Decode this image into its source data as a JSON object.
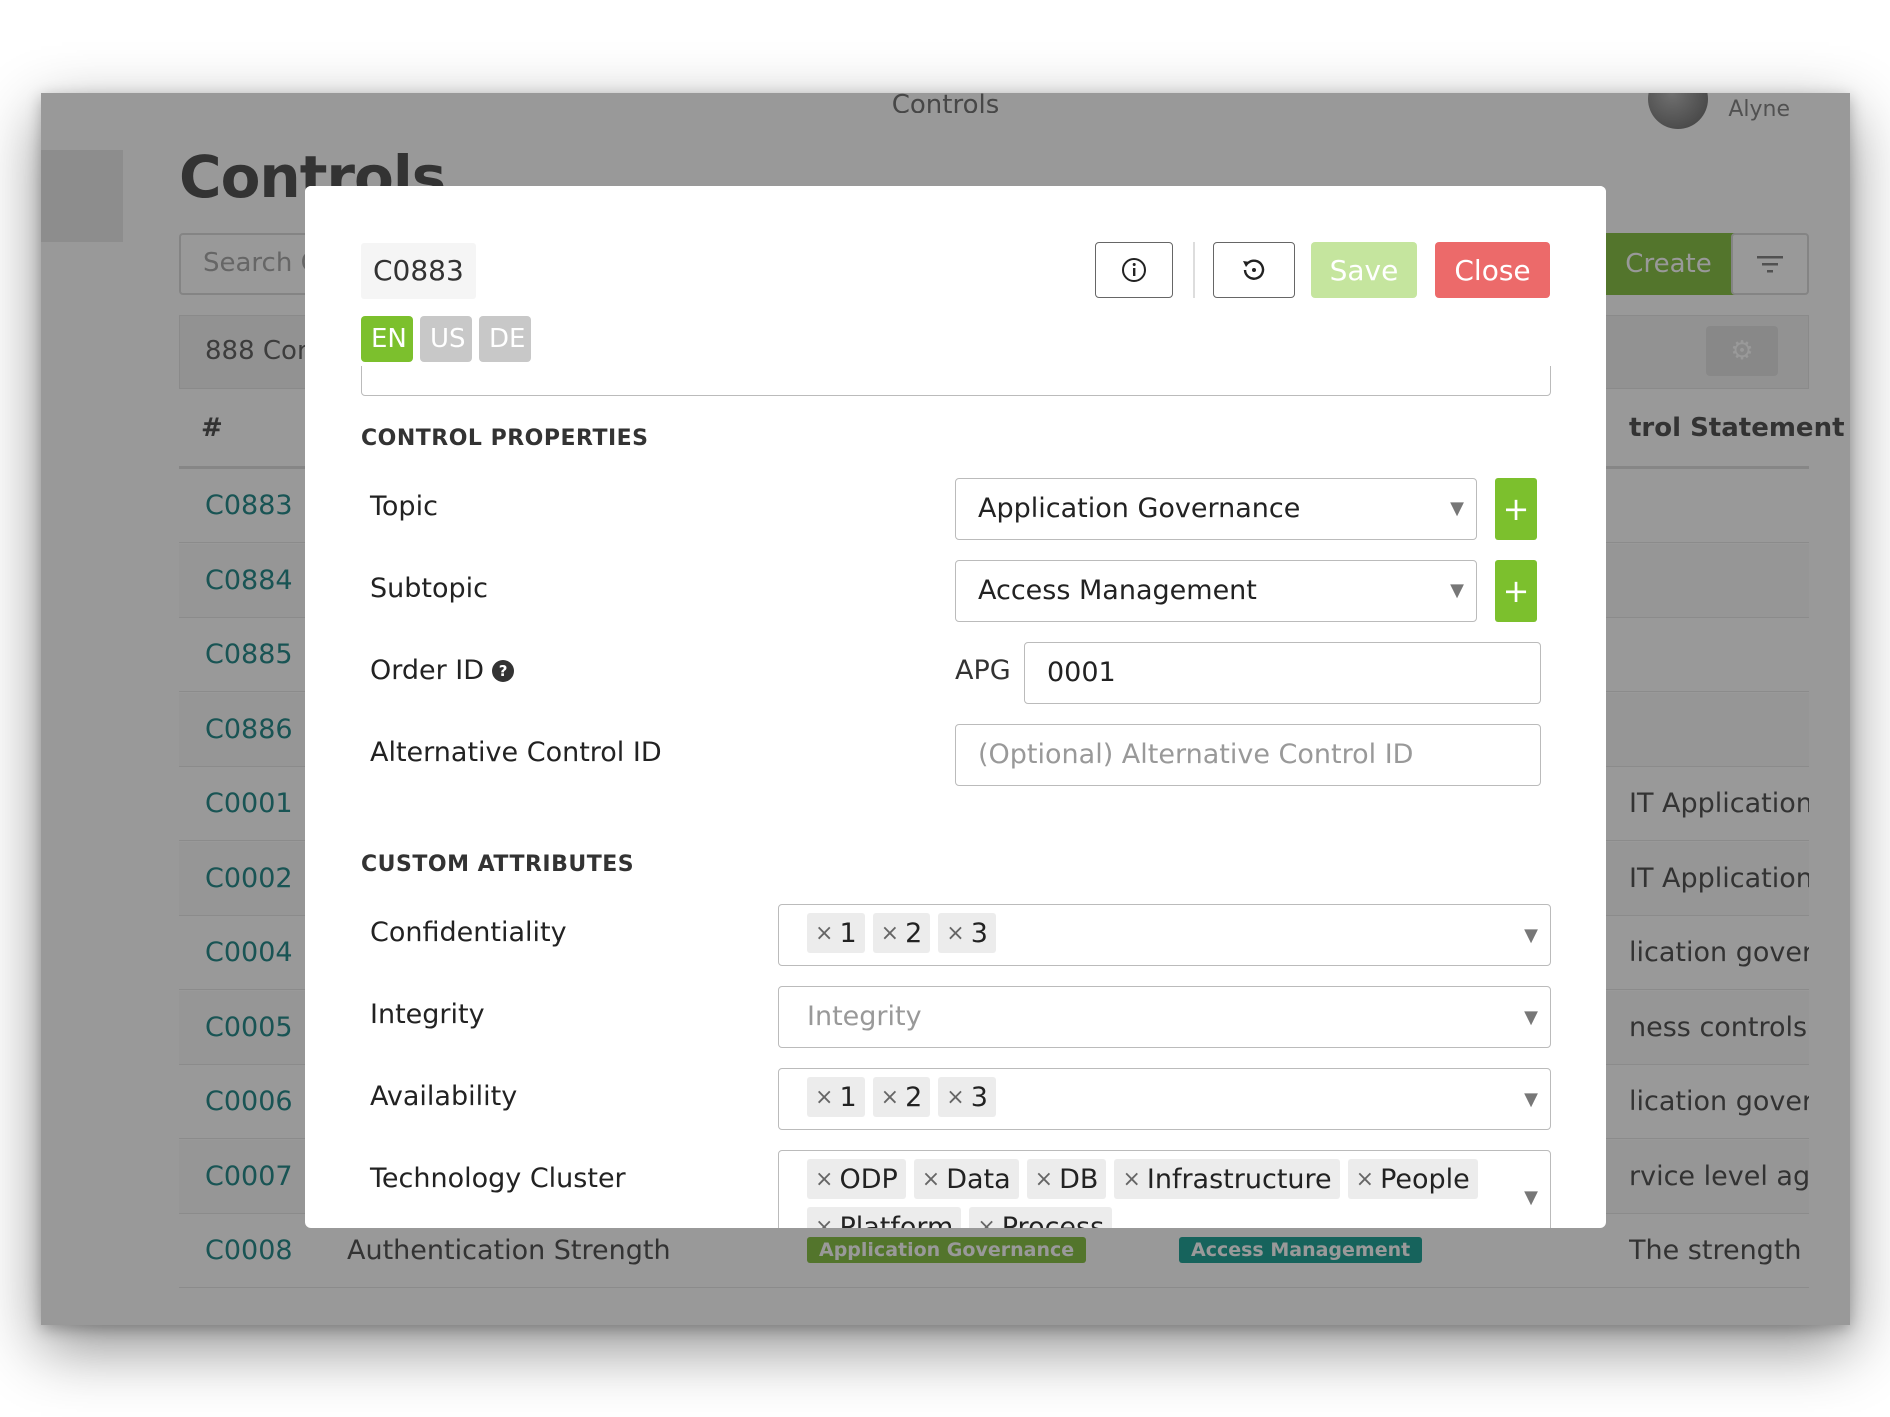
{
  "app": {
    "topbar_title": "Controls",
    "user_name": "Alyne",
    "page_title": "Controls",
    "search_placeholder": "Search C",
    "create_label": "Create",
    "count_text": "888 Con",
    "columns": {
      "hash": "#",
      "statement": "trol Statement"
    },
    "rows": [
      {
        "id": "C0883",
        "name": "",
        "topic": "",
        "sub": "",
        "stmt": ""
      },
      {
        "id": "C0884",
        "name": "",
        "topic": "",
        "sub": "",
        "stmt": ""
      },
      {
        "id": "C0885",
        "name": "",
        "topic": "",
        "sub": "",
        "stmt": ""
      },
      {
        "id": "C0886",
        "name": "",
        "topic": "",
        "sub": "",
        "stmt": ""
      },
      {
        "id": "C0001",
        "name": "",
        "topic": "",
        "sub": "",
        "stmt": "IT Application Ov"
      },
      {
        "id": "C0002",
        "name": "",
        "topic": "",
        "sub": "",
        "stmt": "IT Application Ov"
      },
      {
        "id": "C0004",
        "name": "",
        "topic": "",
        "sub": "",
        "stmt": "lication governan"
      },
      {
        "id": "C0005",
        "name": "",
        "topic": "",
        "sub": "",
        "stmt": "ness controls sha"
      },
      {
        "id": "C0006",
        "name": "",
        "topic": "",
        "sub": "",
        "stmt": "lication governan"
      },
      {
        "id": "C0007",
        "name": "",
        "topic": "",
        "sub": "",
        "stmt": "rvice level agreer"
      },
      {
        "id": "C0008",
        "name": "Authentication Strength",
        "topic": "Application Governance",
        "sub": "Access Management",
        "stmt": "The strength of the a"
      }
    ]
  },
  "modal": {
    "control_id": "C0883",
    "save_label": "Save",
    "close_label": "Close",
    "languages": [
      "EN",
      "US",
      "DE"
    ],
    "active_language": "EN",
    "control_properties_title": "CONTROL PROPERTIES",
    "topic": {
      "label": "Topic",
      "value": "Application Governance"
    },
    "subtopic": {
      "label": "Subtopic",
      "value": "Access Management"
    },
    "order_id": {
      "label": "Order ID",
      "prefix": "APG",
      "value": "0001"
    },
    "alt_control_id": {
      "label": "Alternative Control ID",
      "placeholder": "(Optional) Alternative Control ID"
    },
    "custom_attributes_title": "CUSTOM ATTRIBUTES",
    "confidentiality": {
      "label": "Confidentiality",
      "tags": [
        "1",
        "2",
        "3"
      ]
    },
    "integrity": {
      "label": "Integrity",
      "placeholder": "Integrity",
      "tags": []
    },
    "availability": {
      "label": "Availability",
      "tags": [
        "1",
        "2",
        "3"
      ]
    },
    "technology_cluster": {
      "label": "Technology Cluster",
      "tags": [
        "ODP",
        "Data",
        "DB",
        "Infrastructure",
        "People",
        "Platform",
        "Process"
      ]
    }
  },
  "colors": {
    "accent_green": "#7cc02d",
    "save_disabled": "#c5e59e",
    "close_red": "#ec6a6a",
    "link_teal": "#2a8c8c"
  }
}
